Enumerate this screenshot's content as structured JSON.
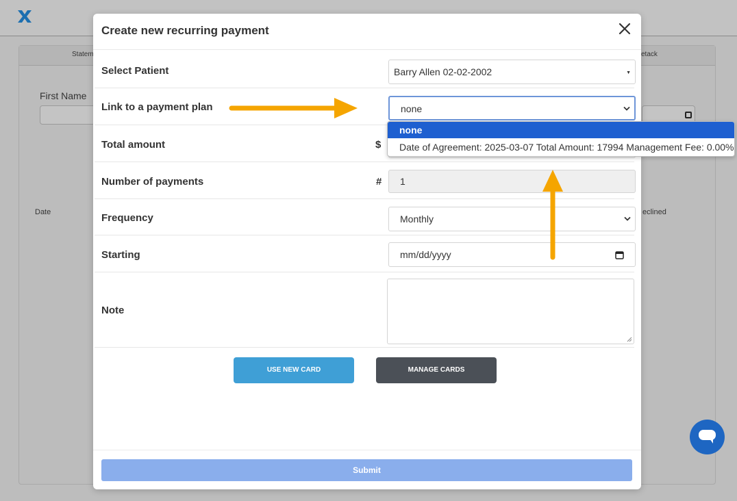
{
  "background": {
    "tabs": {
      "left_partial": "Statem",
      "right_partial": "etack"
    },
    "first_name_label": "First Name",
    "date_label": "Date",
    "declined_label": "eclined"
  },
  "modal": {
    "title": "Create new recurring payment",
    "fields": {
      "patient": {
        "label": "Select Patient",
        "value": "Barry Allen 02-02-2002"
      },
      "plan": {
        "label": "Link to a payment plan",
        "value": "none"
      },
      "total": {
        "label": "Total amount",
        "prefix": "$"
      },
      "payments": {
        "label": "Number of payments",
        "prefix": "#",
        "value": "1"
      },
      "frequency": {
        "label": "Frequency",
        "value": "Monthly"
      },
      "starting": {
        "label": "Starting",
        "placeholder": "mm/dd/yyyy"
      },
      "note": {
        "label": "Note"
      }
    },
    "buttons": {
      "use_new_card": "USE NEW CARD",
      "manage_cards": "MANAGE CARDS",
      "submit": "Submit"
    }
  },
  "dropdown": {
    "options": [
      "none",
      "Date of Agreement: 2025-03-07 Total Amount: 17994 Management Fee: 0.00%"
    ]
  },
  "colors": {
    "accent_blue": "#3f9fd6",
    "dark_button": "#4b5057",
    "submit_disabled": "#8aaeec",
    "selected_option": "#1e5fd0",
    "annotation_arrow": "#f5a500",
    "chat": "#1e66c2"
  },
  "icons": {
    "close": "close-icon",
    "calendar": "calendar-icon",
    "chevron": "chevron-down-icon",
    "chat": "chat-icon",
    "logo": "x-logo-icon"
  }
}
